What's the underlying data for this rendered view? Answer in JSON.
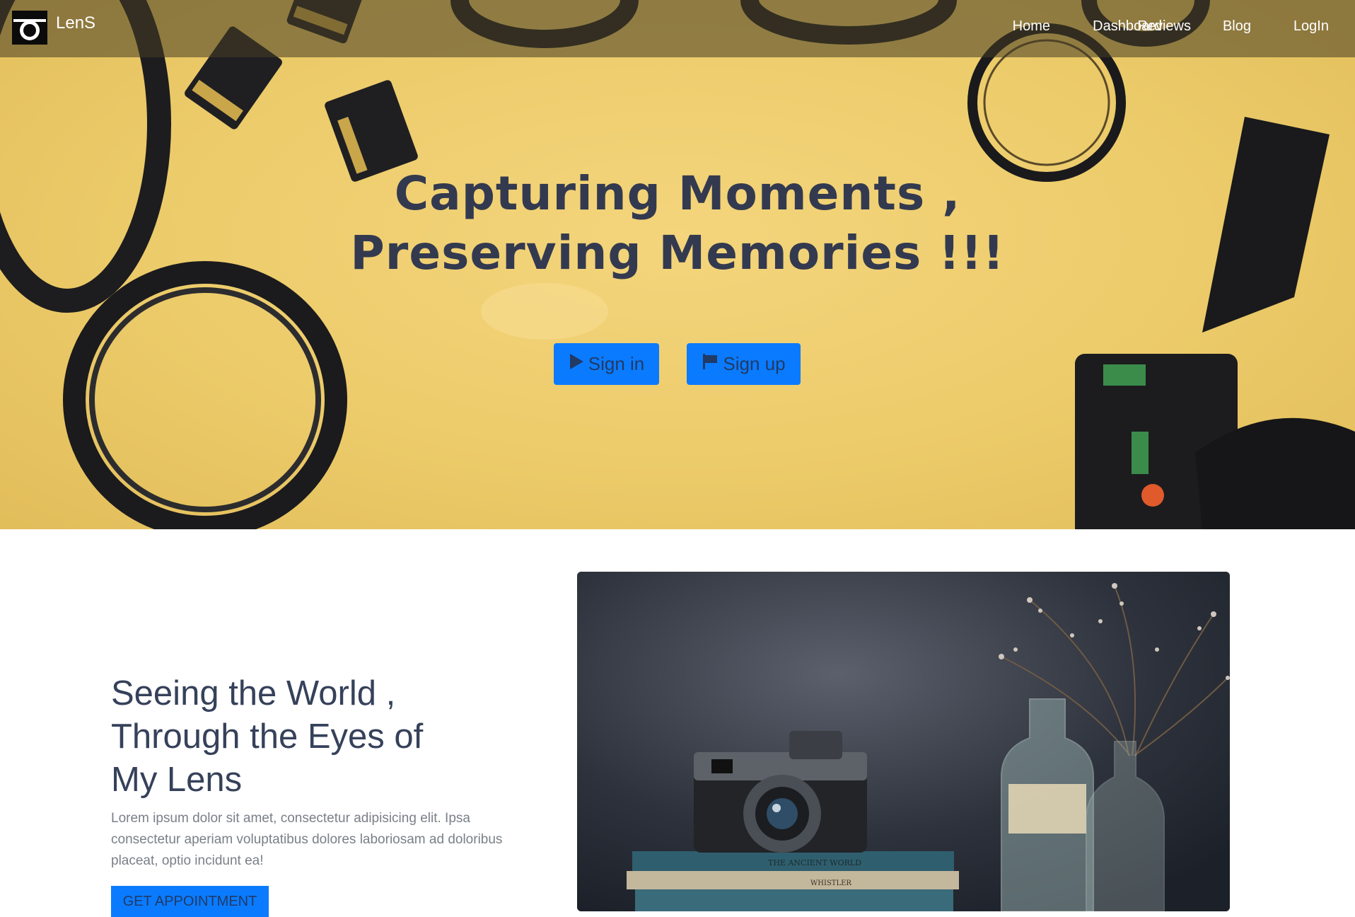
{
  "navbar": {
    "brand": "LenS",
    "links": [
      "Home",
      "Dashboard",
      "Reviews",
      "Blog",
      "LogIn"
    ]
  },
  "hero": {
    "title": "Capturing Moments , Preserving Memories !!!",
    "buttons": {
      "signin": "Sign in",
      "signup": "Sign up"
    }
  },
  "feature": {
    "heading_line1": "Seeing the World ,",
    "heading_line2": "Through the Eyes of",
    "heading_line3": "My Lens",
    "text": "Lorem ipsum dolor sit amet, consectetur adipisicing elit. Ipsa consectetur aperiam voluptatibus dolores laboriosam ad doloribus placeat, optio incidunt ea!",
    "cta": "GET APPOINTMENT",
    "book_titles": [
      "THE ANCIENT WORLD",
      "WHISTLER"
    ]
  },
  "colors": {
    "hero_bg": "#efcf6f",
    "navbar_bg": "rgba(70,60,35,0.55)",
    "accent": "#0a7bff",
    "title": "#333a4f",
    "heading": "#36415a",
    "body_text": "#7a7f88"
  },
  "icons": {
    "brand": "camera-icon",
    "signin": "play-icon",
    "signup": "flag-icon"
  }
}
